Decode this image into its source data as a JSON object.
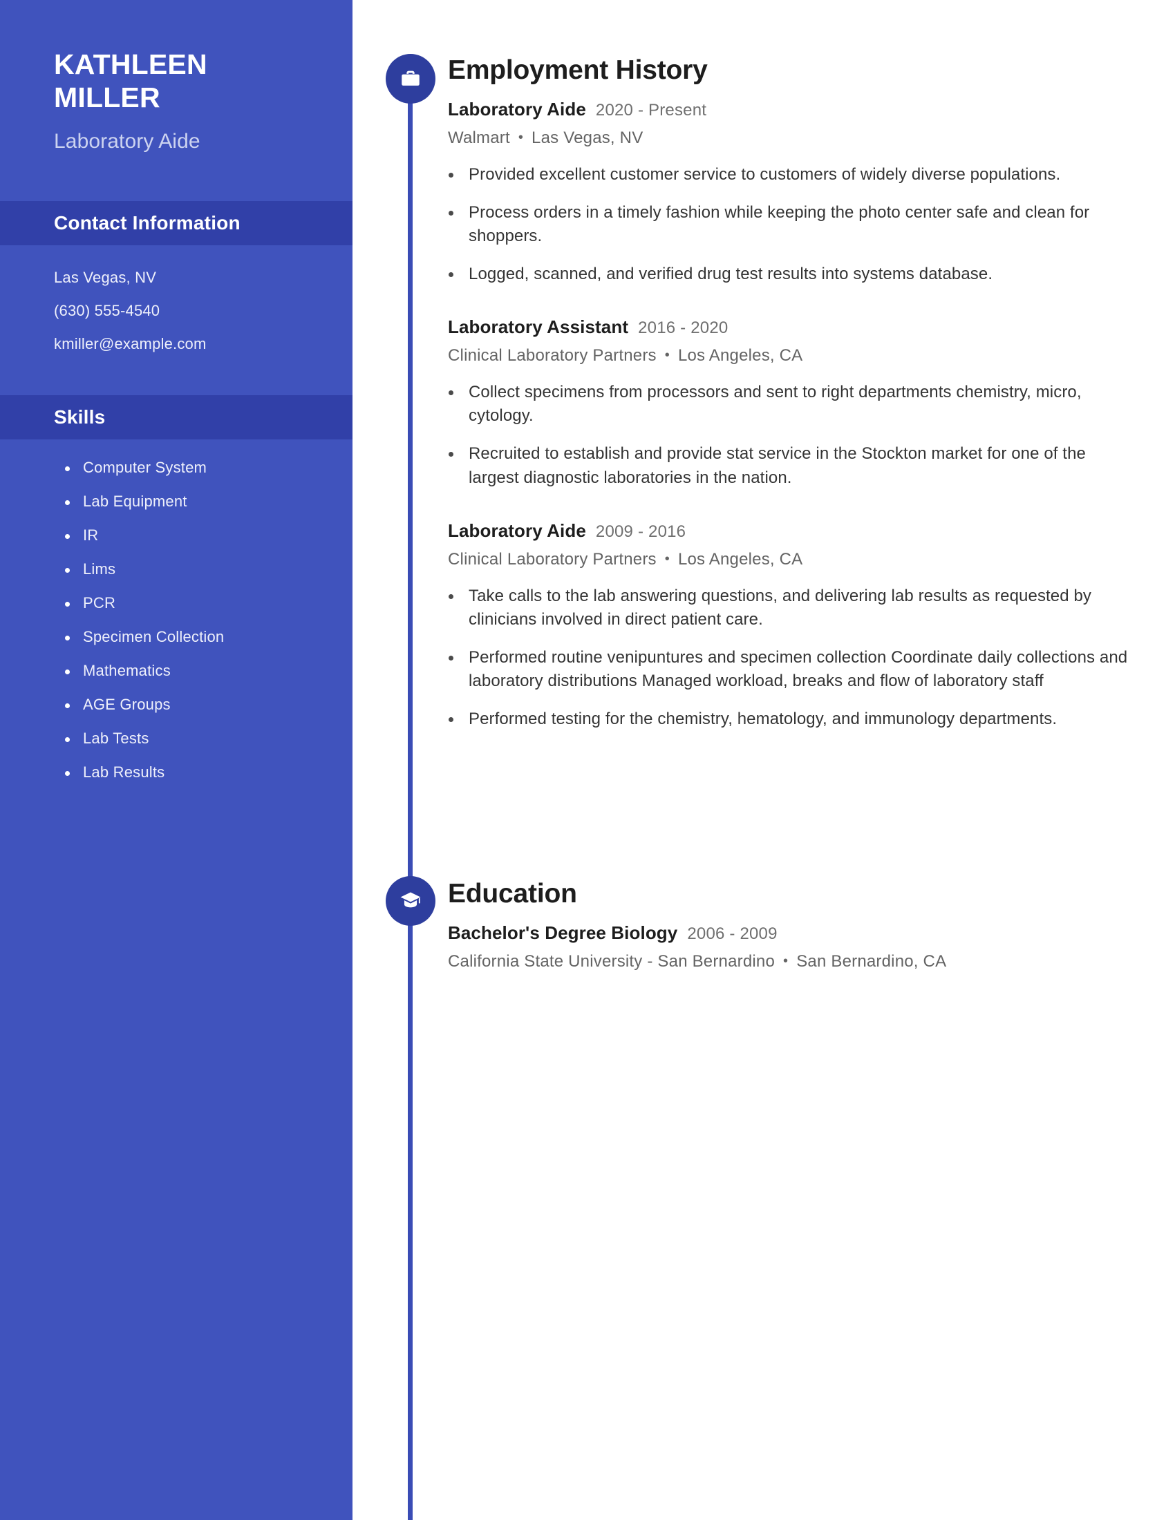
{
  "sidebar": {
    "name": "KATHLEEN\nMILLER",
    "job_title": "Laboratory Aide",
    "contact_heading": "Contact Information",
    "contact": [
      "Las Vegas, NV",
      "(630) 555-4540",
      "kmiller@example.com"
    ],
    "skills_heading": "Skills",
    "skills": [
      "Computer System",
      "Lab Equipment",
      "IR",
      "Lims",
      "PCR",
      "Specimen Collection",
      "Mathematics",
      "AGE Groups",
      "Lab Tests",
      "Lab Results"
    ]
  },
  "employment": {
    "heading": "Employment History",
    "icon": "briefcase-icon",
    "entries": [
      {
        "title": "Laboratory Aide",
        "dates": "2020 - Present",
        "company": "Walmart",
        "location": "Las Vegas, NV",
        "bullets": [
          "Provided excellent customer service to customers of widely diverse populations.",
          "Process orders in a timely fashion while keeping the photo center safe and clean for shoppers.",
          "Logged, scanned, and verified drug test results into systems database."
        ]
      },
      {
        "title": "Laboratory Assistant",
        "dates": "2016 - 2020",
        "company": "Clinical Laboratory Partners",
        "location": "Los Angeles, CA",
        "bullets": [
          "Collect specimens from processors and sent to right departments chemistry, micro, cytology.",
          "Recruited to establish and provide stat service in the Stockton market for one of the largest diagnostic laboratories in the nation."
        ]
      },
      {
        "title": "Laboratory Aide",
        "dates": "2009 - 2016",
        "company": "Clinical Laboratory Partners",
        "location": "Los Angeles, CA",
        "bullets": [
          "Take calls to the lab answering questions, and delivering lab results as requested by clinicians involved in direct patient care.",
          "Performed routine venipuntures and specimen collection Coordinate daily collections and laboratory distributions Managed workload, breaks and flow of laboratory staff",
          "Performed testing for the chemistry, hematology, and immunology departments."
        ]
      }
    ]
  },
  "education": {
    "heading": "Education",
    "icon": "graduation-cap-icon",
    "entries": [
      {
        "title": "Bachelor's Degree Biology",
        "dates": "2006 - 2009",
        "school": "California State University - San Bernardino",
        "location": "San Bernardino, CA"
      }
    ]
  },
  "colors": {
    "sidebar_bg": "#4053bd",
    "sidebar_band": "#3140a8",
    "timeline": "#3a4cb5",
    "dot": "#2e3e9e",
    "heading_text": "#1d1d1d",
    "body_text": "#343434",
    "muted_text": "#6f6f6f"
  },
  "separator": "•"
}
